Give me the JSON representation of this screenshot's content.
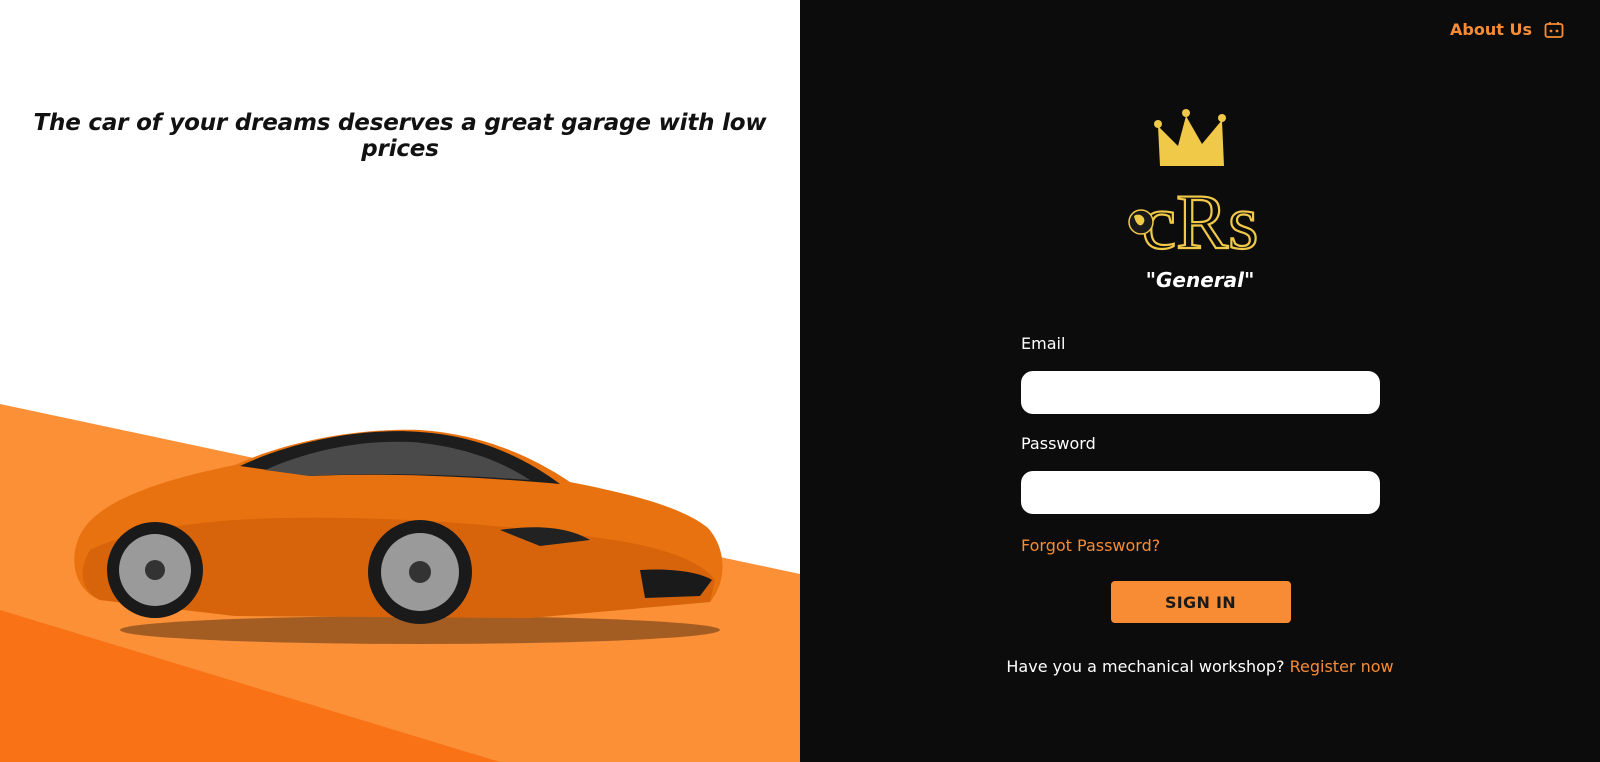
{
  "hero": {
    "tagline": "The car of your dreams deserves a great garage with low prices"
  },
  "nav": {
    "about_label": "About Us",
    "about_icon": "id-card-icon"
  },
  "brand": {
    "logo_text": "cRs",
    "subtitle": "\"General\""
  },
  "login": {
    "email_label": "Email",
    "email_value": "",
    "password_label": "Password",
    "password_value": "",
    "forgot_label": "Forgot Password?",
    "signin_label": "SIGN IN",
    "register_prompt": "Have you a mechanical workshop?",
    "register_link": "Register now"
  },
  "colors": {
    "accent": "#f78c35",
    "dark_bg": "#0c0c0c",
    "logo_gold": "#f1c949",
    "stripe_light": "#fb9037",
    "stripe_dark": "#f97316"
  }
}
